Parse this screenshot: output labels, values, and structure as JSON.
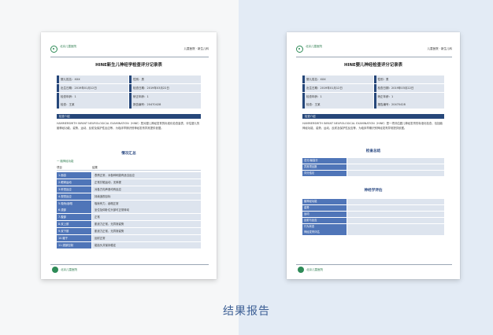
{
  "caption": "结果报告",
  "doc1": {
    "header_logo": "北京儿童医院",
    "header_right": "儿童医院 · 新生儿科",
    "title": "HINE新生儿神经学检查评分记录表",
    "info": [
      [
        "婴儿姓名：XXX",
        "性别：男"
      ],
      [
        "出生日期：2019年01月12日",
        "检查日期：2019年03月22日"
      ],
      [
        "检查年龄：1",
        "矫正年龄：1"
      ],
      [
        "检查：王某",
        "报告编号：20470428"
      ]
    ],
    "section1": "检查介绍",
    "paragraph": "HAMMERSMITH INFANT NEUROLOGICAL EXAMINATION（HINE）是对婴儿神经发育的标准化检查量表，评估婴儿的脑神经功能、姿势、运动、反射及保护性反应等，为临床早期识别神经发育异常提供依据。",
    "summary_title": "情况汇总",
    "summary_sub": "一 脑神经功能",
    "table_head": [
      "项目",
      "结果"
    ],
    "rows": [
      [
        "1.面容",
        "表情正常，对各种刺激有适当反应"
      ],
      [
        "2.眼球运动",
        "正常共轭运动，无斜视"
      ],
      [
        "3.听觉反应",
        "对各方向声音均有反应"
      ],
      [
        "4.视觉反应",
        "持续追视目标"
      ],
      [
        "5.吸吮/吞咽",
        "吸吮有力，吞咽正常"
      ],
      [
        "6.颈部",
        "坐位及仰卧位头部可正常转动"
      ],
      [
        "7.腹部",
        "正常"
      ],
      [
        "8.双上肢",
        "肌张力正常，无异常姿势"
      ],
      [
        "9.双下肢",
        "肌张力正常，无异常姿势"
      ],
      [
        "10.躯干",
        "反射正常"
      ],
      [
        "11.颈部控制",
        "能抬头并保持稳定"
      ]
    ],
    "footer": "北京儿童医院"
  },
  "doc2": {
    "header_logo": "北京儿童医院",
    "header_right": "儿童医院 · 新生儿科",
    "title": "HINE婴儿神经检查评分记录表",
    "info": [
      [
        "婴儿姓名：XXX",
        "性别：男"
      ],
      [
        "出生日期：2019年01月12日",
        "检查日期：2019年03月22日"
      ],
      [
        "检查年龄：1",
        "矫正年龄：1"
      ],
      [
        "检查：王某",
        "报告编号：20470428"
      ]
    ],
    "section1": "检查介绍",
    "paragraph": "HAMMERSMITH INFANT NEUROLOGICAL EXAMINATION（HINE）是一项评估婴儿神经发育的标准化检查，包括脑神经功能、姿势、运动、反射及保护性反应等，为临床早期识别神经发育异常提供依据。",
    "summary_title": "检查总结",
    "summary_rows": [
      "总分/最高分",
      "异常项目数",
      "评分结论"
    ],
    "neuro_title": "神经学评估",
    "neuro_rows": [
      "脑神经功能",
      "姿势",
      "运动",
      "反射与反应",
      "行为状态",
      "神经发育评估"
    ],
    "footer": "北京儿童医院"
  }
}
